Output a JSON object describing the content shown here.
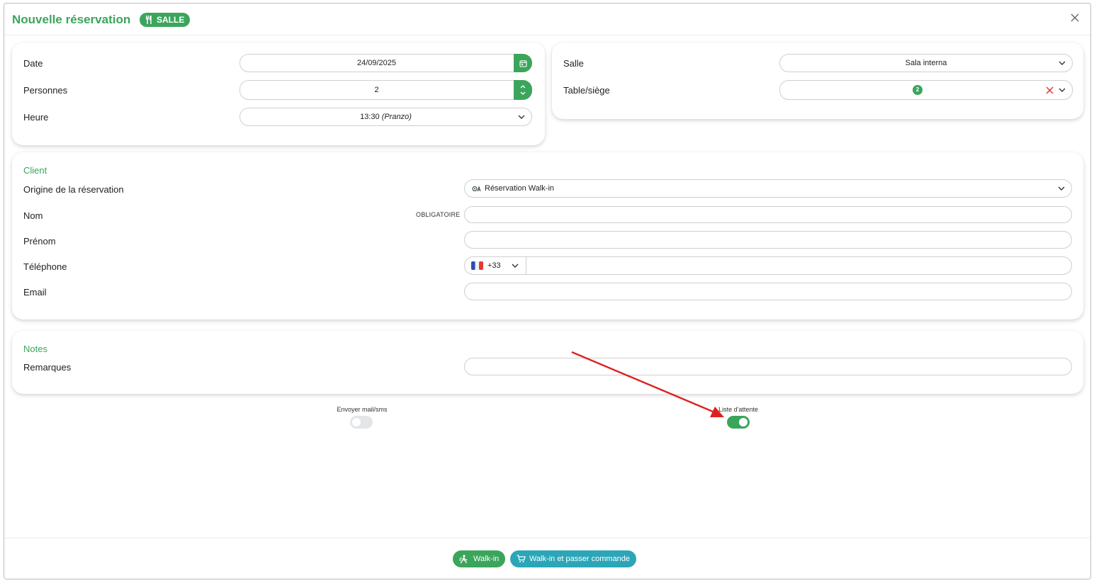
{
  "header": {
    "title": "Nouvelle réservation",
    "badge": "SALLE"
  },
  "booking": {
    "date_label": "Date",
    "date_value": "24/09/2025",
    "persons_label": "Personnes",
    "persons_value": "2",
    "time_label": "Heure",
    "time_value": "13:30",
    "time_service": "(Pranzo)"
  },
  "room": {
    "room_label": "Salle",
    "room_value": "Sala interna",
    "table_label": "Table/siège",
    "table_value": "2"
  },
  "client": {
    "section_title": "Client",
    "origin_label": "Origine de la réservation",
    "origin_value": "Réservation Walk-in",
    "name_label": "Nom",
    "name_required": "OBLIGATOIRE",
    "name_value": "",
    "firstname_label": "Prénom",
    "firstname_value": "",
    "phone_label": "Téléphone",
    "phone_prefix": "+33",
    "phone_value": "",
    "email_label": "Email",
    "email_value": ""
  },
  "notes": {
    "section_title": "Notes",
    "remarks_label": "Remarques",
    "remarks_value": ""
  },
  "options": {
    "send_label": "Envoyer mail/sms",
    "send_on": false,
    "waitlist_label": "Liste d'attente",
    "waitlist_on": true
  },
  "footer": {
    "walkin_label": "Walk-in",
    "walkin_order_label": "Walk-in et passer commande"
  },
  "colors": {
    "accent": "#3ba55c",
    "teal": "#2ba6b8",
    "annotation_arrow": "#e02020",
    "clear_x": "#e53935"
  },
  "icons": [
    "utensils-icon",
    "close-icon",
    "calendar-icon",
    "stepper-icon",
    "chevron-down-icon",
    "walkin-person-icon",
    "flag-fr-icon",
    "cart-icon"
  ]
}
